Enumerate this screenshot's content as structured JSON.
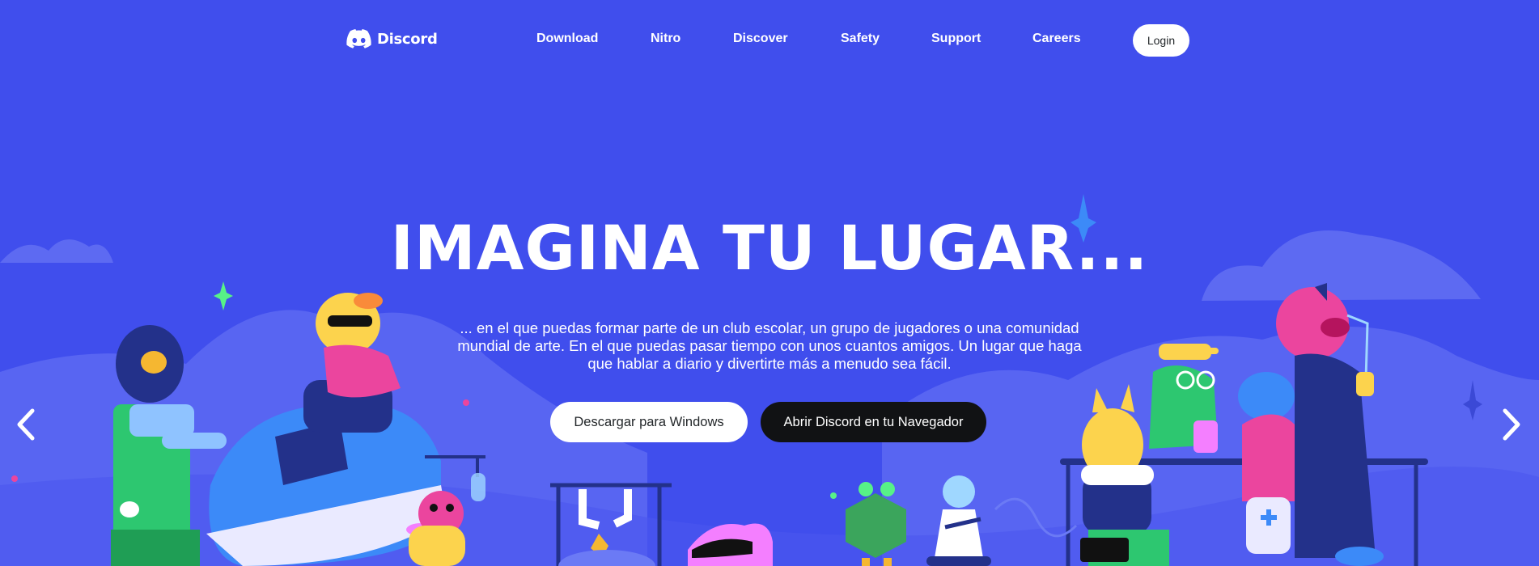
{
  "brand": {
    "name": "Discord",
    "logo_icon": "discord-logo-icon"
  },
  "nav": {
    "links": [
      "Download",
      "Nitro",
      "Discover",
      "Safety",
      "Support",
      "Careers"
    ],
    "login_label": "Login"
  },
  "hero": {
    "title": "IMAGINA TU LUGAR...",
    "description": "... en el que puedas formar parte de un club escolar, un grupo de jugadores o una comunidad mundial de arte. En el que puedas pasar tiempo con unos cuantos amigos. Un lugar que haga que hablar a diario y divertirte más a menudo sea fácil.",
    "download_button": "Descargar para Windows",
    "browser_button": "Abrir Discord en tu Navegador"
  },
  "carousel": {
    "prev_icon": "chevron-left-icon",
    "next_icon": "chevron-right-icon"
  },
  "colors": {
    "background": "#404eed",
    "hill": "#5865f2",
    "cloud": "#5d6af2",
    "dark_button": "#111214",
    "text": "#ffffff"
  }
}
